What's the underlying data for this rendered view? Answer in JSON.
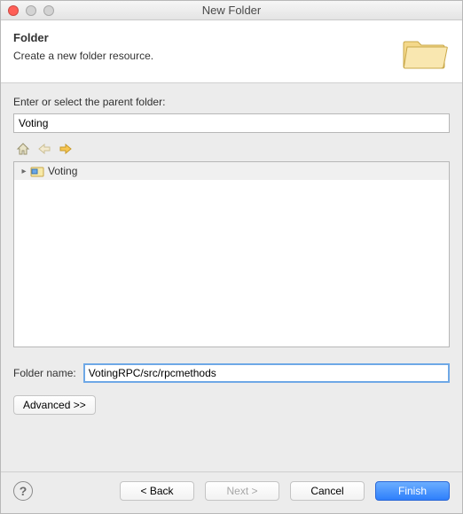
{
  "window": {
    "title": "New Folder"
  },
  "header": {
    "title": "Folder",
    "subtitle": "Create a new folder resource."
  },
  "parent": {
    "label": "Enter or select the parent folder:",
    "value": "Voting"
  },
  "tree": {
    "items": [
      {
        "label": "Voting"
      }
    ]
  },
  "folderName": {
    "label": "Folder name:",
    "value": "VotingRPC/src/rpcmethods"
  },
  "advanced": {
    "label": "Advanced >>"
  },
  "footer": {
    "back": "< Back",
    "next": "Next >",
    "cancel": "Cancel",
    "finish": "Finish"
  }
}
